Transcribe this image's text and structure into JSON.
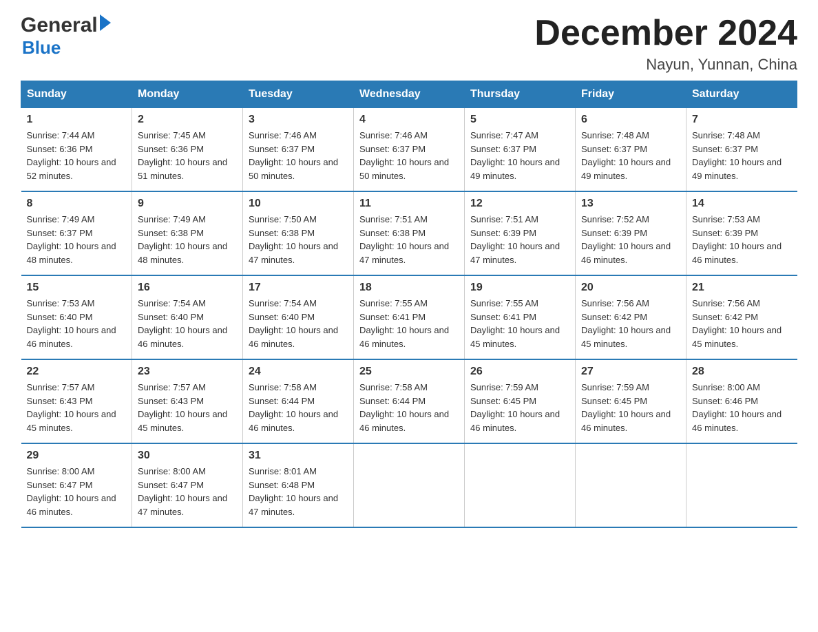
{
  "header": {
    "month_title": "December 2024",
    "location": "Nayun, Yunnan, China",
    "logo_general": "General",
    "logo_blue": "Blue"
  },
  "columns": [
    "Sunday",
    "Monday",
    "Tuesday",
    "Wednesday",
    "Thursday",
    "Friday",
    "Saturday"
  ],
  "weeks": [
    [
      {
        "day": "1",
        "sunrise": "7:44 AM",
        "sunset": "6:36 PM",
        "daylight": "10 hours and 52 minutes."
      },
      {
        "day": "2",
        "sunrise": "7:45 AM",
        "sunset": "6:36 PM",
        "daylight": "10 hours and 51 minutes."
      },
      {
        "day": "3",
        "sunrise": "7:46 AM",
        "sunset": "6:37 PM",
        "daylight": "10 hours and 50 minutes."
      },
      {
        "day": "4",
        "sunrise": "7:46 AM",
        "sunset": "6:37 PM",
        "daylight": "10 hours and 50 minutes."
      },
      {
        "day": "5",
        "sunrise": "7:47 AM",
        "sunset": "6:37 PM",
        "daylight": "10 hours and 49 minutes."
      },
      {
        "day": "6",
        "sunrise": "7:48 AM",
        "sunset": "6:37 PM",
        "daylight": "10 hours and 49 minutes."
      },
      {
        "day": "7",
        "sunrise": "7:48 AM",
        "sunset": "6:37 PM",
        "daylight": "10 hours and 49 minutes."
      }
    ],
    [
      {
        "day": "8",
        "sunrise": "7:49 AM",
        "sunset": "6:37 PM",
        "daylight": "10 hours and 48 minutes."
      },
      {
        "day": "9",
        "sunrise": "7:49 AM",
        "sunset": "6:38 PM",
        "daylight": "10 hours and 48 minutes."
      },
      {
        "day": "10",
        "sunrise": "7:50 AM",
        "sunset": "6:38 PM",
        "daylight": "10 hours and 47 minutes."
      },
      {
        "day": "11",
        "sunrise": "7:51 AM",
        "sunset": "6:38 PM",
        "daylight": "10 hours and 47 minutes."
      },
      {
        "day": "12",
        "sunrise": "7:51 AM",
        "sunset": "6:39 PM",
        "daylight": "10 hours and 47 minutes."
      },
      {
        "day": "13",
        "sunrise": "7:52 AM",
        "sunset": "6:39 PM",
        "daylight": "10 hours and 46 minutes."
      },
      {
        "day": "14",
        "sunrise": "7:53 AM",
        "sunset": "6:39 PM",
        "daylight": "10 hours and 46 minutes."
      }
    ],
    [
      {
        "day": "15",
        "sunrise": "7:53 AM",
        "sunset": "6:40 PM",
        "daylight": "10 hours and 46 minutes."
      },
      {
        "day": "16",
        "sunrise": "7:54 AM",
        "sunset": "6:40 PM",
        "daylight": "10 hours and 46 minutes."
      },
      {
        "day": "17",
        "sunrise": "7:54 AM",
        "sunset": "6:40 PM",
        "daylight": "10 hours and 46 minutes."
      },
      {
        "day": "18",
        "sunrise": "7:55 AM",
        "sunset": "6:41 PM",
        "daylight": "10 hours and 46 minutes."
      },
      {
        "day": "19",
        "sunrise": "7:55 AM",
        "sunset": "6:41 PM",
        "daylight": "10 hours and 45 minutes."
      },
      {
        "day": "20",
        "sunrise": "7:56 AM",
        "sunset": "6:42 PM",
        "daylight": "10 hours and 45 minutes."
      },
      {
        "day": "21",
        "sunrise": "7:56 AM",
        "sunset": "6:42 PM",
        "daylight": "10 hours and 45 minutes."
      }
    ],
    [
      {
        "day": "22",
        "sunrise": "7:57 AM",
        "sunset": "6:43 PM",
        "daylight": "10 hours and 45 minutes."
      },
      {
        "day": "23",
        "sunrise": "7:57 AM",
        "sunset": "6:43 PM",
        "daylight": "10 hours and 45 minutes."
      },
      {
        "day": "24",
        "sunrise": "7:58 AM",
        "sunset": "6:44 PM",
        "daylight": "10 hours and 46 minutes."
      },
      {
        "day": "25",
        "sunrise": "7:58 AM",
        "sunset": "6:44 PM",
        "daylight": "10 hours and 46 minutes."
      },
      {
        "day": "26",
        "sunrise": "7:59 AM",
        "sunset": "6:45 PM",
        "daylight": "10 hours and 46 minutes."
      },
      {
        "day": "27",
        "sunrise": "7:59 AM",
        "sunset": "6:45 PM",
        "daylight": "10 hours and 46 minutes."
      },
      {
        "day": "28",
        "sunrise": "8:00 AM",
        "sunset": "6:46 PM",
        "daylight": "10 hours and 46 minutes."
      }
    ],
    [
      {
        "day": "29",
        "sunrise": "8:00 AM",
        "sunset": "6:47 PM",
        "daylight": "10 hours and 46 minutes."
      },
      {
        "day": "30",
        "sunrise": "8:00 AM",
        "sunset": "6:47 PM",
        "daylight": "10 hours and 47 minutes."
      },
      {
        "day": "31",
        "sunrise": "8:01 AM",
        "sunset": "6:48 PM",
        "daylight": "10 hours and 47 minutes."
      },
      {
        "day": "",
        "sunrise": "",
        "sunset": "",
        "daylight": ""
      },
      {
        "day": "",
        "sunrise": "",
        "sunset": "",
        "daylight": ""
      },
      {
        "day": "",
        "sunrise": "",
        "sunset": "",
        "daylight": ""
      },
      {
        "day": "",
        "sunrise": "",
        "sunset": "",
        "daylight": ""
      }
    ]
  ]
}
